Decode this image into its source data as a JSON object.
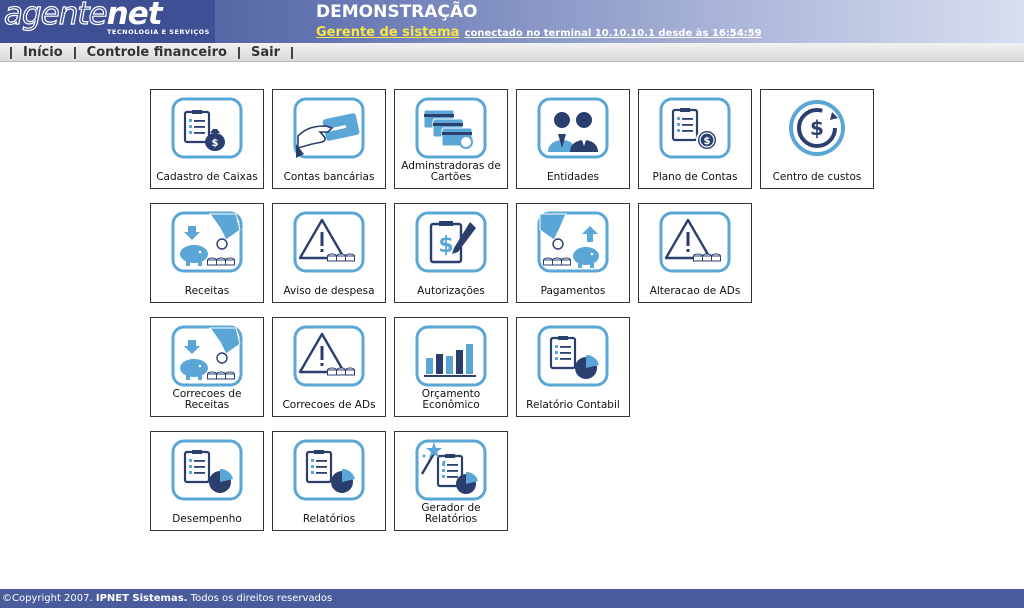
{
  "header": {
    "logo": "agentenet",
    "logo_sub": "TECNOLOGIA E SERVIÇOS",
    "title": "DEMONSTRAÇÃO",
    "role": "Gerente de sistema",
    "connection": "conectado no terminal 10.10.10.1 desde às 16:54:59"
  },
  "nav": {
    "items": [
      {
        "label": "Início"
      },
      {
        "label": "Controle financeiro"
      },
      {
        "label": "Sair"
      }
    ]
  },
  "tiles": [
    {
      "label": "Cadastro de Caixas",
      "icon": "clipboard-moneybag-icon"
    },
    {
      "label": "Contas bancárias",
      "icon": "hand-card-icon"
    },
    {
      "label": "Adminstradoras de Cartões",
      "icon": "cards-stack-icon"
    },
    {
      "label": "Entidades",
      "icon": "people-icon"
    },
    {
      "label": "Plano de Contas",
      "icon": "clipboard-coin-icon"
    },
    {
      "label": "Centro de custos",
      "icon": "dollar-cycle-icon"
    },
    {
      "label": "Receitas",
      "icon": "piggy-bank-down-icon"
    },
    {
      "label": "Aviso de despesa",
      "icon": "warning-coins-icon"
    },
    {
      "label": "Autorizações",
      "icon": "clipboard-dollar-pen-icon"
    },
    {
      "label": "Pagamentos",
      "icon": "piggy-bank-up-icon"
    },
    {
      "label": "Alteracao de ADs",
      "icon": "warning-coins-icon"
    },
    {
      "label": "Correcoes de Receitas",
      "icon": "piggy-bank-down-icon"
    },
    {
      "label": "Correcoes de ADs",
      "icon": "warning-coins-icon"
    },
    {
      "label": "Orçamento Econômico",
      "icon": "bar-chart-icon"
    },
    {
      "label": "Relatório Contabil",
      "icon": "report-pie-icon"
    },
    {
      "label": "Desempenho",
      "icon": "report-pie-icon"
    },
    {
      "label": "Relatórios",
      "icon": "report-pie-icon"
    },
    {
      "label": "Gerador de Relatórios",
      "icon": "report-wand-icon"
    }
  ],
  "footer": {
    "copyright": "©Copyright 2007.",
    "company": "IPNET Sistemas.",
    "rights": "Todos os direitos reservados"
  },
  "colors": {
    "header": "#3e4f93",
    "icon_dark": "#2a3f6e",
    "icon_light": "#5aa6d6",
    "footer": "#4b5c9d"
  }
}
